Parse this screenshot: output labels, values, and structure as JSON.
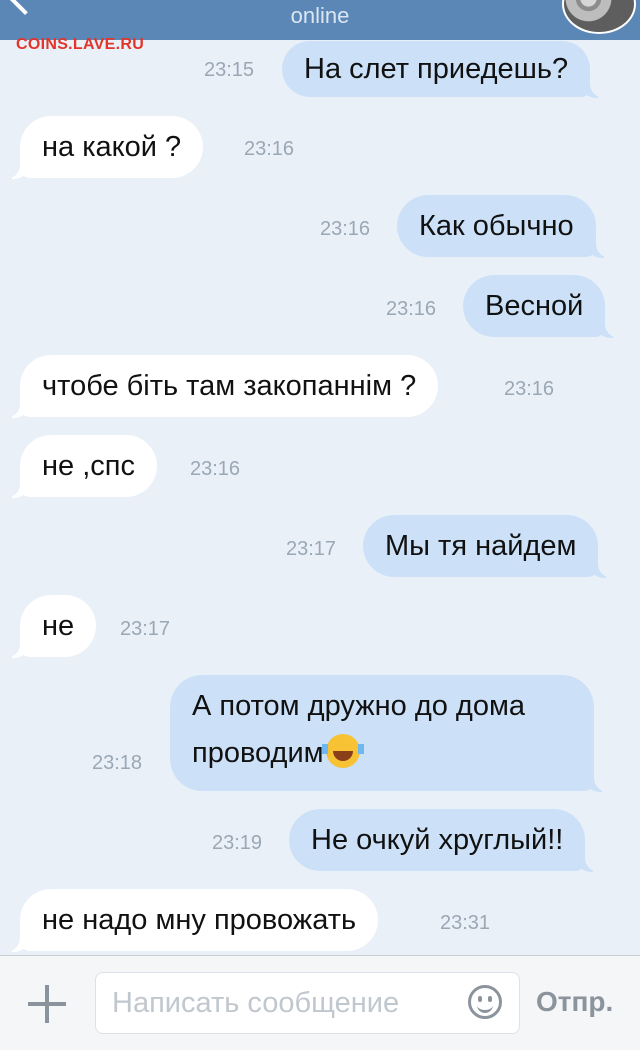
{
  "header": {
    "status": "online",
    "watermark": "COINS.LAVE.RU"
  },
  "messages": [
    {
      "direction": "out",
      "text": "На слет приедешь?",
      "time": "23:15"
    },
    {
      "direction": "in",
      "text": "на какой ?",
      "time": "23:16"
    },
    {
      "direction": "out",
      "text": "Как обычно",
      "time": "23:16"
    },
    {
      "direction": "out",
      "text": "Весной",
      "time": "23:16"
    },
    {
      "direction": "in",
      "text": "чтобе біть там закопаннім ?",
      "time": "23:16"
    },
    {
      "direction": "in",
      "text": "не ,спс",
      "time": "23:16"
    },
    {
      "direction": "out",
      "text": "Мы тя найдем",
      "time": "23:17"
    },
    {
      "direction": "in",
      "text": "не",
      "time": "23:17"
    },
    {
      "direction": "out",
      "text_line1": "А потом дружно до дома",
      "text_line2": "проводим",
      "emoji": "face-with-tears-of-joy-icon",
      "time": "23:18"
    },
    {
      "direction": "out",
      "text": "Не очкуй хруглый!!",
      "time": "23:19"
    },
    {
      "direction": "in",
      "text": "не надо мну провожать",
      "time": "23:31"
    }
  ],
  "composer": {
    "placeholder": "Написать сообщение",
    "send_label": "Отпр."
  },
  "colors": {
    "header": "#5b87b7",
    "background": "#eaf0f7",
    "outgoing_bubble": "#cce1f8",
    "incoming_bubble": "#ffffff",
    "watermark": "#e2342a"
  }
}
